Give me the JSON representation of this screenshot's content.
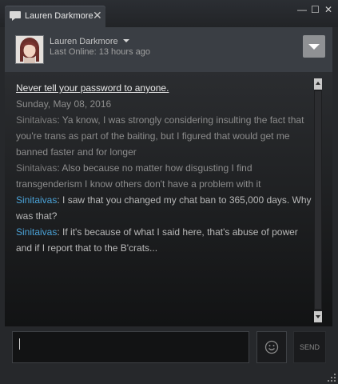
{
  "window": {
    "tab_title": "Lauren Darkmore",
    "tab_close": "✕",
    "minimize": "—",
    "maximize": "☐",
    "close": "✕"
  },
  "header": {
    "friend_name": "Lauren Darkmore",
    "last_online": "Last Online: 13 hours ago"
  },
  "chat": {
    "warning": "Never tell your password to anyone.",
    "date": "Sunday, May 08, 2016",
    "messages": [
      {
        "sender": "Sinitaivas",
        "text": ": Ya know, I was strongly considering insulting the fact that you're trans as part of the baiting, but I figured that would get me banned faster and for longer"
      },
      {
        "sender": "Sinitaivas",
        "text": ": Also because no matter how disgusting I find transgenderism I know others don't have a problem with it"
      },
      {
        "sender": "Sinitaivas",
        "text": ": I saw that you changed my chat ban to 365,000 days. Why was that?"
      },
      {
        "sender": "Sinitaivas",
        "text": ": If it's because of what I said here, that's abuse of power and if I report that to the B'crats..."
      }
    ]
  },
  "composer": {
    "input_value": "",
    "send_label": "SEND"
  },
  "colors": {
    "sender_link": "#4aa1d6",
    "message_text": "#b8b8b8",
    "faded_text": "#8c8c8c"
  }
}
